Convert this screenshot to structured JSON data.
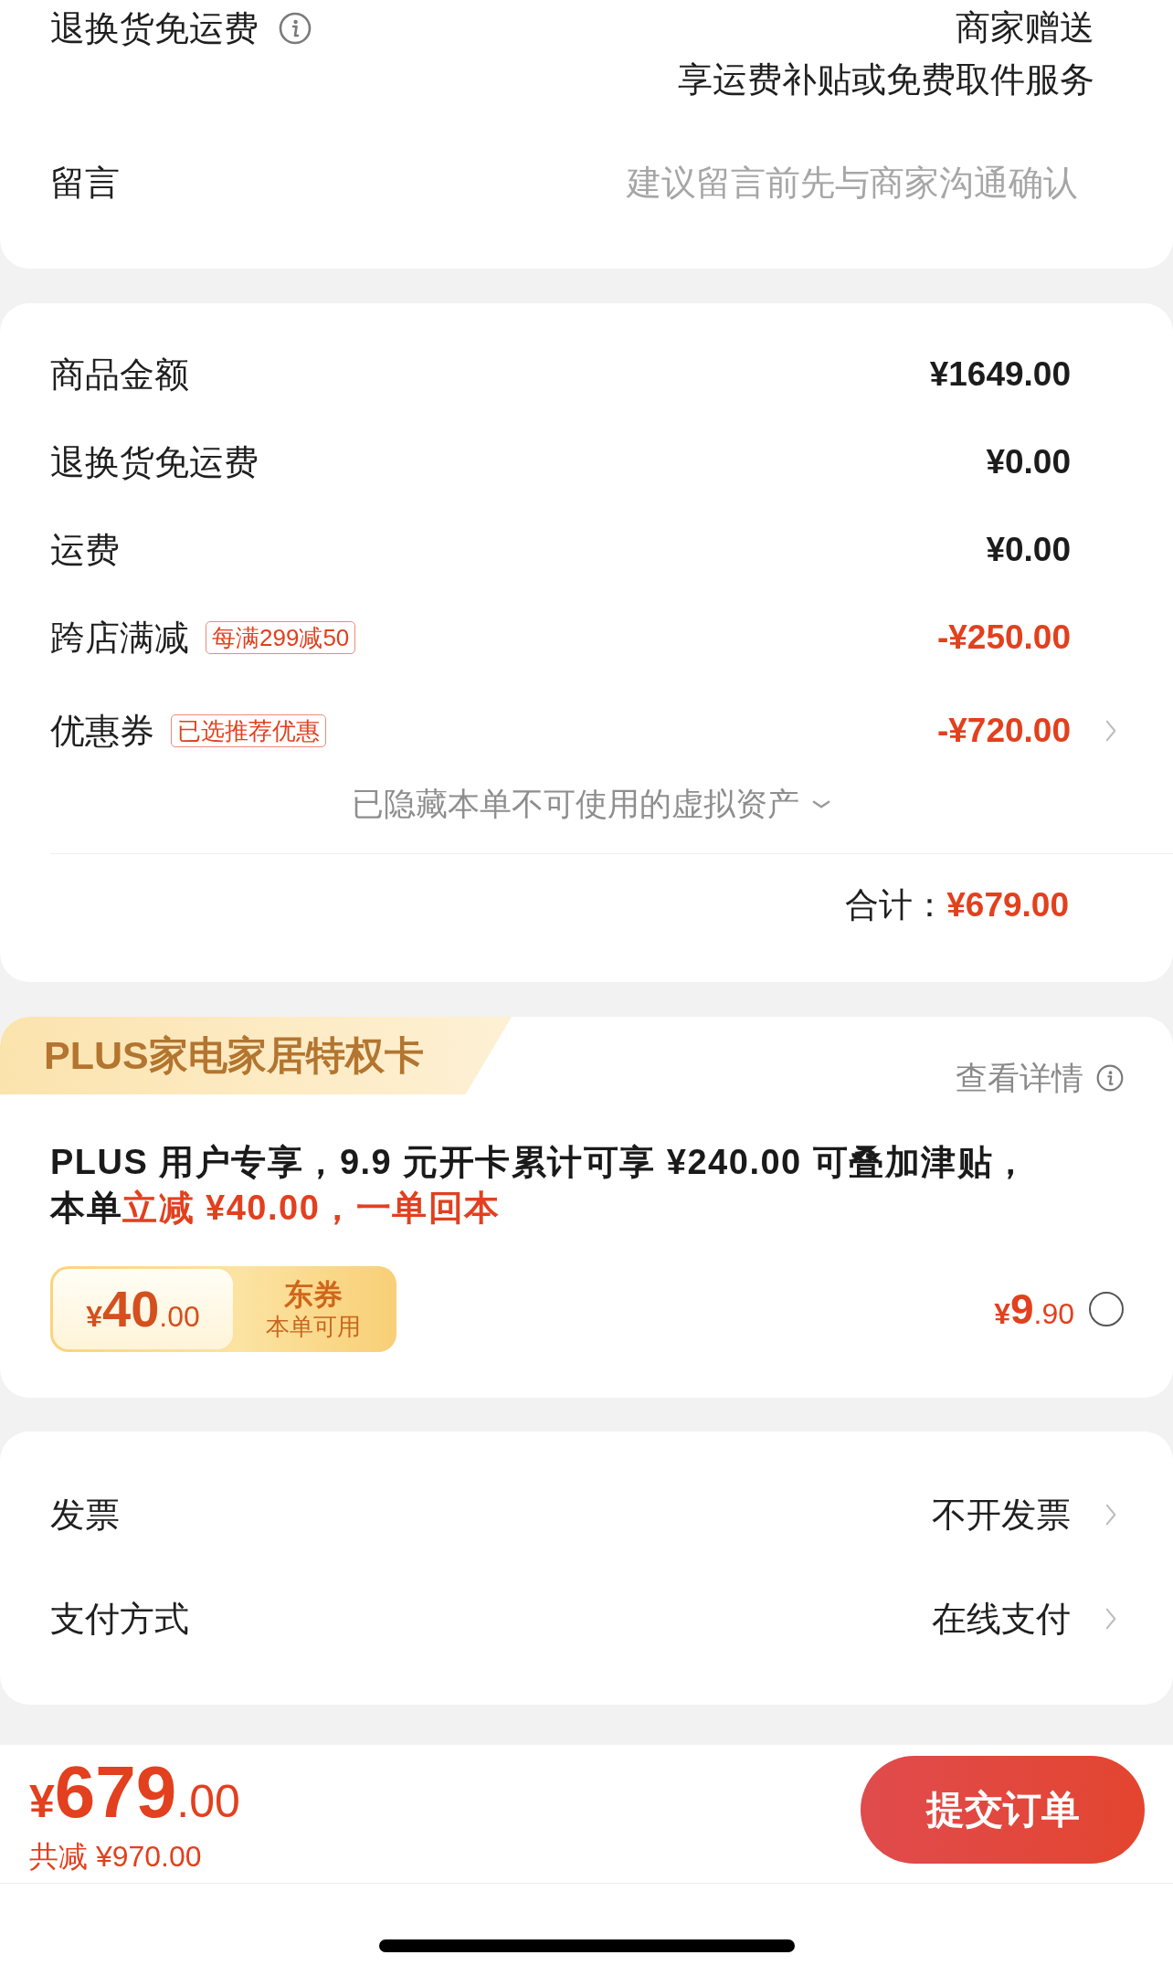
{
  "delivery_card": {
    "rows": [
      {
        "kind": "info",
        "label": "退换货免运费",
        "value_lines": [
          "商家赠送",
          "享运费补贴或免费取件服务"
        ]
      },
      {
        "kind": "input",
        "label": "留言",
        "placeholder": "建议留言前先与商家沟通确认"
      }
    ]
  },
  "price_card": {
    "rows": [
      {
        "kind": "plain",
        "label": "商品金额",
        "amount": "¥1649.00",
        "arrow": false
      },
      {
        "kind": "plain",
        "label": "退换货免运费",
        "amount": "¥0.00",
        "arrow": false
      },
      {
        "kind": "plain",
        "label": "运费",
        "amount": "¥0.00",
        "arrow": false
      },
      {
        "kind": "deduction",
        "label": "跨店满减",
        "tag": "每满299减50",
        "amount": "-¥250.00",
        "arrow": false
      },
      {
        "kind": "deduction",
        "label": "优惠券",
        "tag": "已选推荐优惠",
        "amount": "-¥720.00",
        "arrow": true
      }
    ],
    "hidden_assets": {
      "text": "已隐藏本单不可使用的虚拟资产",
      "expanded": false
    },
    "total": {
      "label": "合计：",
      "amount": "¥679.00"
    }
  },
  "plus_card": {
    "title": "PLUS家电家居特权卡",
    "details_link": "查看详情",
    "description": [
      [
        {
          "text": "PLUS 用户专享，9.9 元开卡累计可享 ¥240.00 可叠加津贴，",
          "highlight": false
        }
      ],
      [
        {
          "text": "本单",
          "highlight": false
        },
        {
          "text": "立减 ¥40.00，一单回本",
          "highlight": true
        }
      ]
    ],
    "coupon": {
      "currency": "¥",
      "integer": "40",
      "decimal": ".00",
      "name": "东券",
      "note": "本单可用"
    },
    "price": {
      "currency": "¥",
      "integer": "9",
      "decimal": ".90"
    },
    "selected": false
  },
  "options_card": {
    "rows": [
      {
        "label": "发票",
        "value": "不开发票"
      },
      {
        "label": "支付方式",
        "value": "在线支付"
      }
    ]
  },
  "bottom_bar": {
    "total": {
      "currency": "¥",
      "integer": "679",
      "decimal": ".00"
    },
    "savings": "共减 ¥970.00",
    "submit": "提交订单"
  }
}
